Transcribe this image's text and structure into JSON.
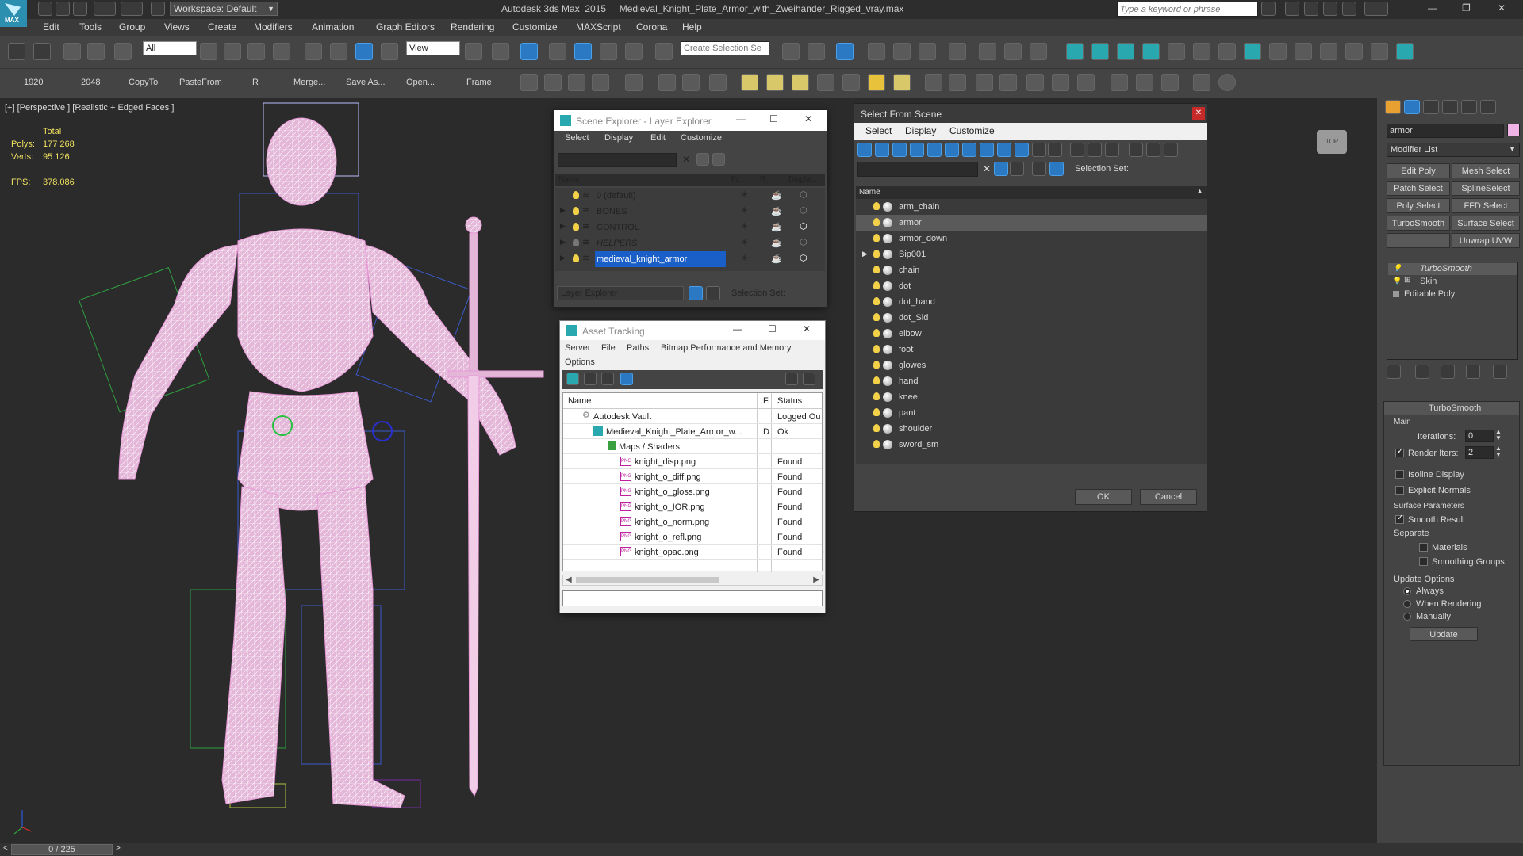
{
  "app": {
    "logo": "MAX",
    "title": "Autodesk 3ds Max  2015     Medieval_Knight_Plate_Armor_with_Zweihander_Rigged_vray.max",
    "workspace": "Workspace: Default",
    "search_placeholder": "Type a keyword or phrase"
  },
  "menu": [
    "Edit",
    "Tools",
    "Group",
    "Views",
    "Create",
    "Modifiers",
    "Animation",
    "Graph Editors",
    "Rendering",
    "Customize",
    "MAXScript",
    "Corona",
    "Help"
  ],
  "toolbar1": {
    "filter": "All",
    "refcoord": "View",
    "selset_placeholder": "Create Selection Se"
  },
  "toolbar2": {
    "labels": [
      "1920",
      "2048",
      "CopyTo",
      "PasteFrom",
      "R",
      "Merge...",
      "Save As...",
      "Open...",
      "Frame"
    ]
  },
  "viewport": {
    "label": "[+] [Perspective ] [Realistic + Edged Faces ]",
    "stats": {
      "total_label": "Total",
      "polys_label": "Polys:",
      "polys": "177 268",
      "verts_label": "Verts:",
      "verts": "95 126",
      "fps_label": "FPS:",
      "fps": "378.086"
    },
    "viewcube": "TOP"
  },
  "scene_explorer": {
    "title": "Scene Explorer - Layer Explorer",
    "menu": [
      "Select",
      "Display",
      "Edit",
      "Customize"
    ],
    "columns": [
      "Name",
      "Fr...",
      "R...",
      "Displa..."
    ],
    "rows": [
      {
        "name": "0 (default)"
      },
      {
        "name": "BONES"
      },
      {
        "name": "CONTROL"
      },
      {
        "name": "HELPERS"
      },
      {
        "name": "medieval_knight_armor"
      }
    ],
    "footer_dropdown": "Layer Explorer",
    "footer_selset": "Selection Set:"
  },
  "asset_tracking": {
    "title": "Asset Tracking",
    "menu": [
      "Server",
      "File",
      "Paths",
      "Bitmap Performance and Memory",
      "Options"
    ],
    "columns": [
      "Name",
      "F.",
      "Status"
    ],
    "rows": [
      {
        "name": "Autodesk Vault",
        "f": "",
        "status": "Logged Ou"
      },
      {
        "name": "Medieval_Knight_Plate_Armor_w...",
        "f": "D",
        "status": "Ok"
      },
      {
        "name": "Maps / Shaders",
        "f": "",
        "status": ""
      },
      {
        "name": "knight_disp.png",
        "f": "",
        "status": "Found"
      },
      {
        "name": "knight_o_diff.png",
        "f": "",
        "status": "Found"
      },
      {
        "name": "knight_o_gloss.png",
        "f": "",
        "status": "Found"
      },
      {
        "name": "knight_o_IOR.png",
        "f": "",
        "status": "Found"
      },
      {
        "name": "knight_o_norm.png",
        "f": "",
        "status": "Found"
      },
      {
        "name": "knight_o_refl.png",
        "f": "",
        "status": "Found"
      },
      {
        "name": "knight_opac.png",
        "f": "",
        "status": "Found"
      }
    ]
  },
  "select_from_scene": {
    "title": "Select From Scene",
    "menu": [
      "Select",
      "Display",
      "Customize"
    ],
    "selset_label": "Selection Set:",
    "column": "Name",
    "items": [
      "arm_chain",
      "armor",
      "armor_down",
      "Bip001",
      "chain",
      "dot",
      "dot_hand",
      "dot_Sld",
      "elbow",
      "foot",
      "glowes",
      "hand",
      "knee",
      "pant",
      "shoulder",
      "sword_sm"
    ],
    "selected": "armor",
    "ok": "OK",
    "cancel": "Cancel"
  },
  "command_panel": {
    "object_name": "armor",
    "modifier_list": "Modifier List",
    "buttons": [
      "Edit Poly",
      "Mesh Select",
      "Patch Select",
      "SplineSelect",
      "Poly Select",
      "FFD Select",
      "TurboSmooth",
      "Surface Select",
      "Unwrap UVW"
    ],
    "stack": [
      "TurboSmooth",
      "Skin",
      "Editable Poly"
    ],
    "turbosmooth": {
      "title": "TurboSmooth",
      "main_label": "Main",
      "iterations_label": "Iterations:",
      "iterations": "0",
      "render_iters_label": "Render Iters:",
      "render_iters": "2",
      "isoline": "Isoline Display",
      "explicit": "Explicit Normals",
      "surface_params": "Surface Parameters",
      "smooth_result": "Smooth Result",
      "separate": "Separate",
      "materials": "Materials",
      "smoothing_groups": "Smoothing Groups",
      "update_options": "Update Options",
      "always": "Always",
      "when_rendering": "When Rendering",
      "manually": "Manually",
      "update": "Update"
    }
  },
  "status": {
    "frame": "0 / 225"
  }
}
